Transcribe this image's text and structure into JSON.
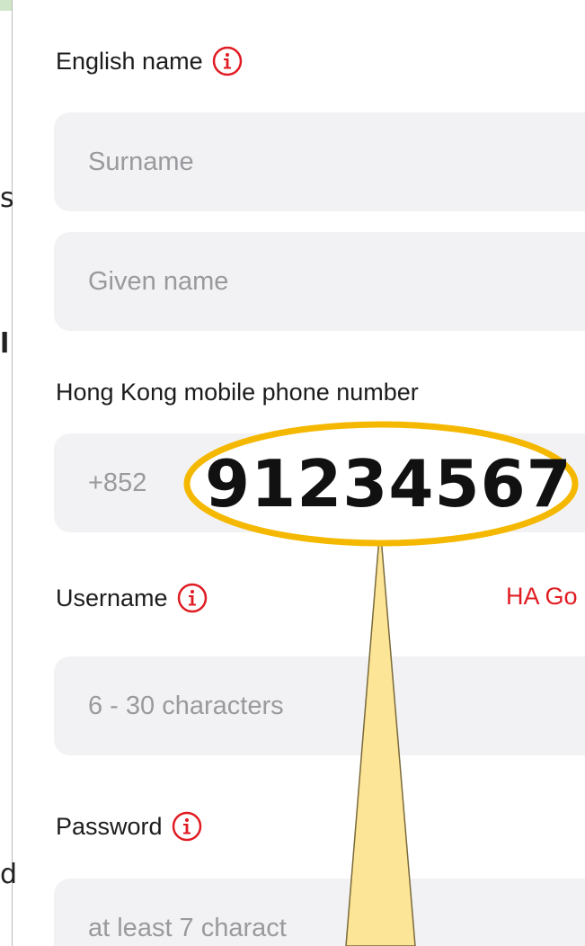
{
  "form": {
    "english_name_label": "English name",
    "surname_placeholder": "Surname",
    "given_name_placeholder": "Given name",
    "phone_label": "Hong Kong mobile phone number",
    "phone_prefix": "+852",
    "username_label": "Username",
    "ha_link_partial": "HA Go",
    "username_placeholder": "6 - 30 characters",
    "password_label": "Password",
    "password_placeholder_partial": "at least 7 charact"
  },
  "annotation": {
    "phone_example": "91234567"
  },
  "edge_fragments": [
    "s",
    "l",
    "d"
  ],
  "colors": {
    "accent_red": "#e01b22",
    "field_bg": "#f2f2f4",
    "callout_yellow": "#f5b800",
    "callout_fill": "#fde598"
  }
}
